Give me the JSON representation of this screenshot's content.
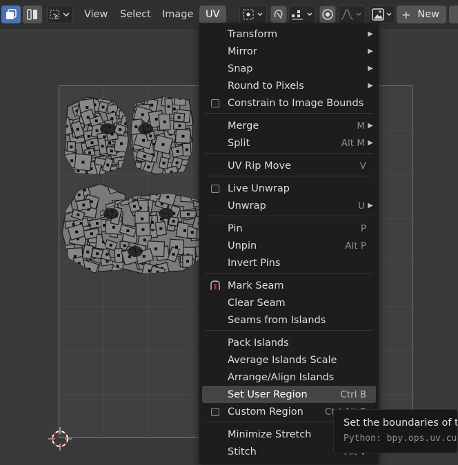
{
  "header": {
    "menus": [
      "View",
      "Select",
      "Image",
      "UV"
    ],
    "active_menu": "UV",
    "new_label": "New",
    "icons": {
      "mode_a": "uv-editor-mode-icon",
      "mode_b": "split-view-icon",
      "selection": "selection-mode-icon",
      "pivot": "pivot-point-icon",
      "sync": "sync-selection-icon",
      "snap": "snap-icon",
      "proportional": "proportional-edit-icon",
      "falloff": "falloff-curve-icon",
      "image_browse": "image-browse-icon",
      "new": "plus-icon"
    }
  },
  "menu": {
    "items": [
      {
        "label": "Transform",
        "shortcut": "",
        "submenu": true,
        "checkbox": false
      },
      {
        "label": "Mirror",
        "shortcut": "",
        "submenu": true,
        "checkbox": false
      },
      {
        "label": "Snap",
        "shortcut": "",
        "submenu": true,
        "checkbox": false
      },
      {
        "label": "Round to Pixels",
        "shortcut": "",
        "submenu": true,
        "checkbox": false
      },
      {
        "label": "Constrain to Image Bounds",
        "shortcut": "",
        "submenu": false,
        "checkbox": true
      },
      {
        "label": "Merge",
        "shortcut": "M",
        "submenu": true,
        "checkbox": false
      },
      {
        "label": "Split",
        "shortcut": "Alt M",
        "submenu": true,
        "checkbox": false
      },
      {
        "label": "UV Rip Move",
        "shortcut": "V",
        "submenu": false,
        "checkbox": false
      },
      {
        "label": "Live Unwrap",
        "shortcut": "",
        "submenu": false,
        "checkbox": true
      },
      {
        "label": "Unwrap",
        "shortcut": "U",
        "submenu": true,
        "checkbox": false
      },
      {
        "label": "Pin",
        "shortcut": "P",
        "submenu": false,
        "checkbox": false
      },
      {
        "label": "Unpin",
        "shortcut": "Alt P",
        "submenu": false,
        "checkbox": false
      },
      {
        "label": "Invert Pins",
        "shortcut": "",
        "submenu": false,
        "checkbox": false
      },
      {
        "label": "Mark Seam",
        "shortcut": "",
        "submenu": false,
        "checkbox": false,
        "icon": "mark-seam-icon"
      },
      {
        "label": "Clear Seam",
        "shortcut": "",
        "submenu": false,
        "checkbox": false
      },
      {
        "label": "Seams from Islands",
        "shortcut": "",
        "submenu": false,
        "checkbox": false
      },
      {
        "label": "Pack Islands",
        "shortcut": "",
        "submenu": false,
        "checkbox": false
      },
      {
        "label": "Average Islands Scale",
        "shortcut": "",
        "submenu": false,
        "checkbox": false
      },
      {
        "label": "Arrange/Align Islands",
        "shortcut": "",
        "submenu": false,
        "checkbox": false
      },
      {
        "label": "Set User Region",
        "shortcut": "Ctrl B",
        "submenu": false,
        "checkbox": false,
        "highlighted": true
      },
      {
        "label": "Custom Region",
        "shortcut": "Ctrl Alt B",
        "submenu": false,
        "checkbox": true
      },
      {
        "label": "Minimize Stretch",
        "shortcut": "",
        "submenu": false,
        "checkbox": false
      },
      {
        "label": "Stitch",
        "shortcut": "Alt V",
        "submenu": false,
        "checkbox": false
      }
    ]
  },
  "tooltip": {
    "description": "Set the boundaries of the user region",
    "python": "Python: bpy.ops.uv.custom_region_set()"
  },
  "colors": {
    "accent": "#4772b3",
    "menu_bg": "#1d1d1d",
    "highlight": "#454545",
    "viewport_bg": "#3a3a3a",
    "seam_icon": "#b52d2d"
  }
}
